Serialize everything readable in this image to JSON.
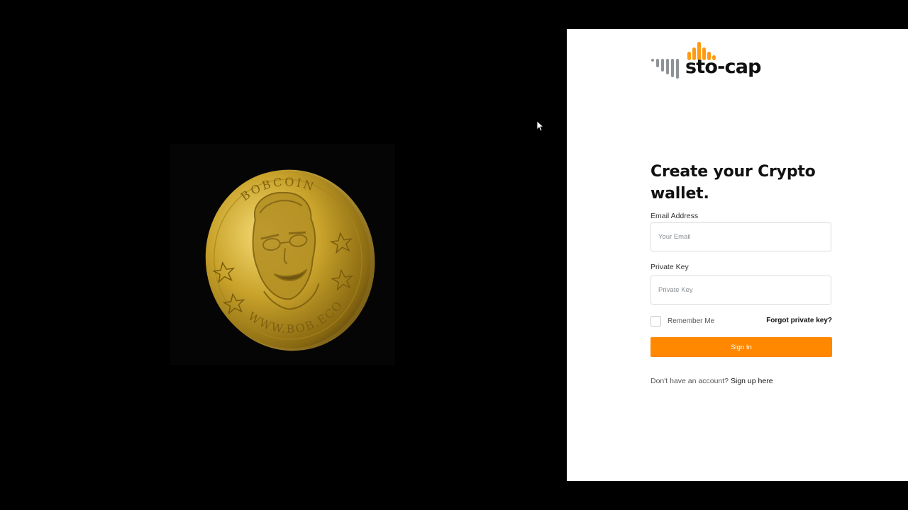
{
  "colors": {
    "background": "#000000",
    "panel": "#ffffff",
    "accent": "#ff8800",
    "coin_gold": "#c9a32b"
  },
  "left": {
    "coin_image": {
      "description_icon": "bobcoin-coin-image",
      "engraved_top": "BOBCOIN",
      "engraved_bottom": "WWW.BOB.ECO"
    }
  },
  "logo": {
    "text": "sto-cap",
    "icon": "sound-bars-logo-icon"
  },
  "form": {
    "heading": "Create your Crypto wallet.",
    "email_label": "Email Address",
    "email_placeholder": "Your Email",
    "email_value": "",
    "key_label": "Private Key",
    "key_placeholder": "Private Key",
    "key_value": "",
    "remember_label": "Remember Me",
    "remember_checked": false,
    "forgot_label": "Forgot private key?",
    "submit_label": "Sign In",
    "signup_prompt": "Don't have an account?",
    "signup_link": "Sign up here"
  }
}
